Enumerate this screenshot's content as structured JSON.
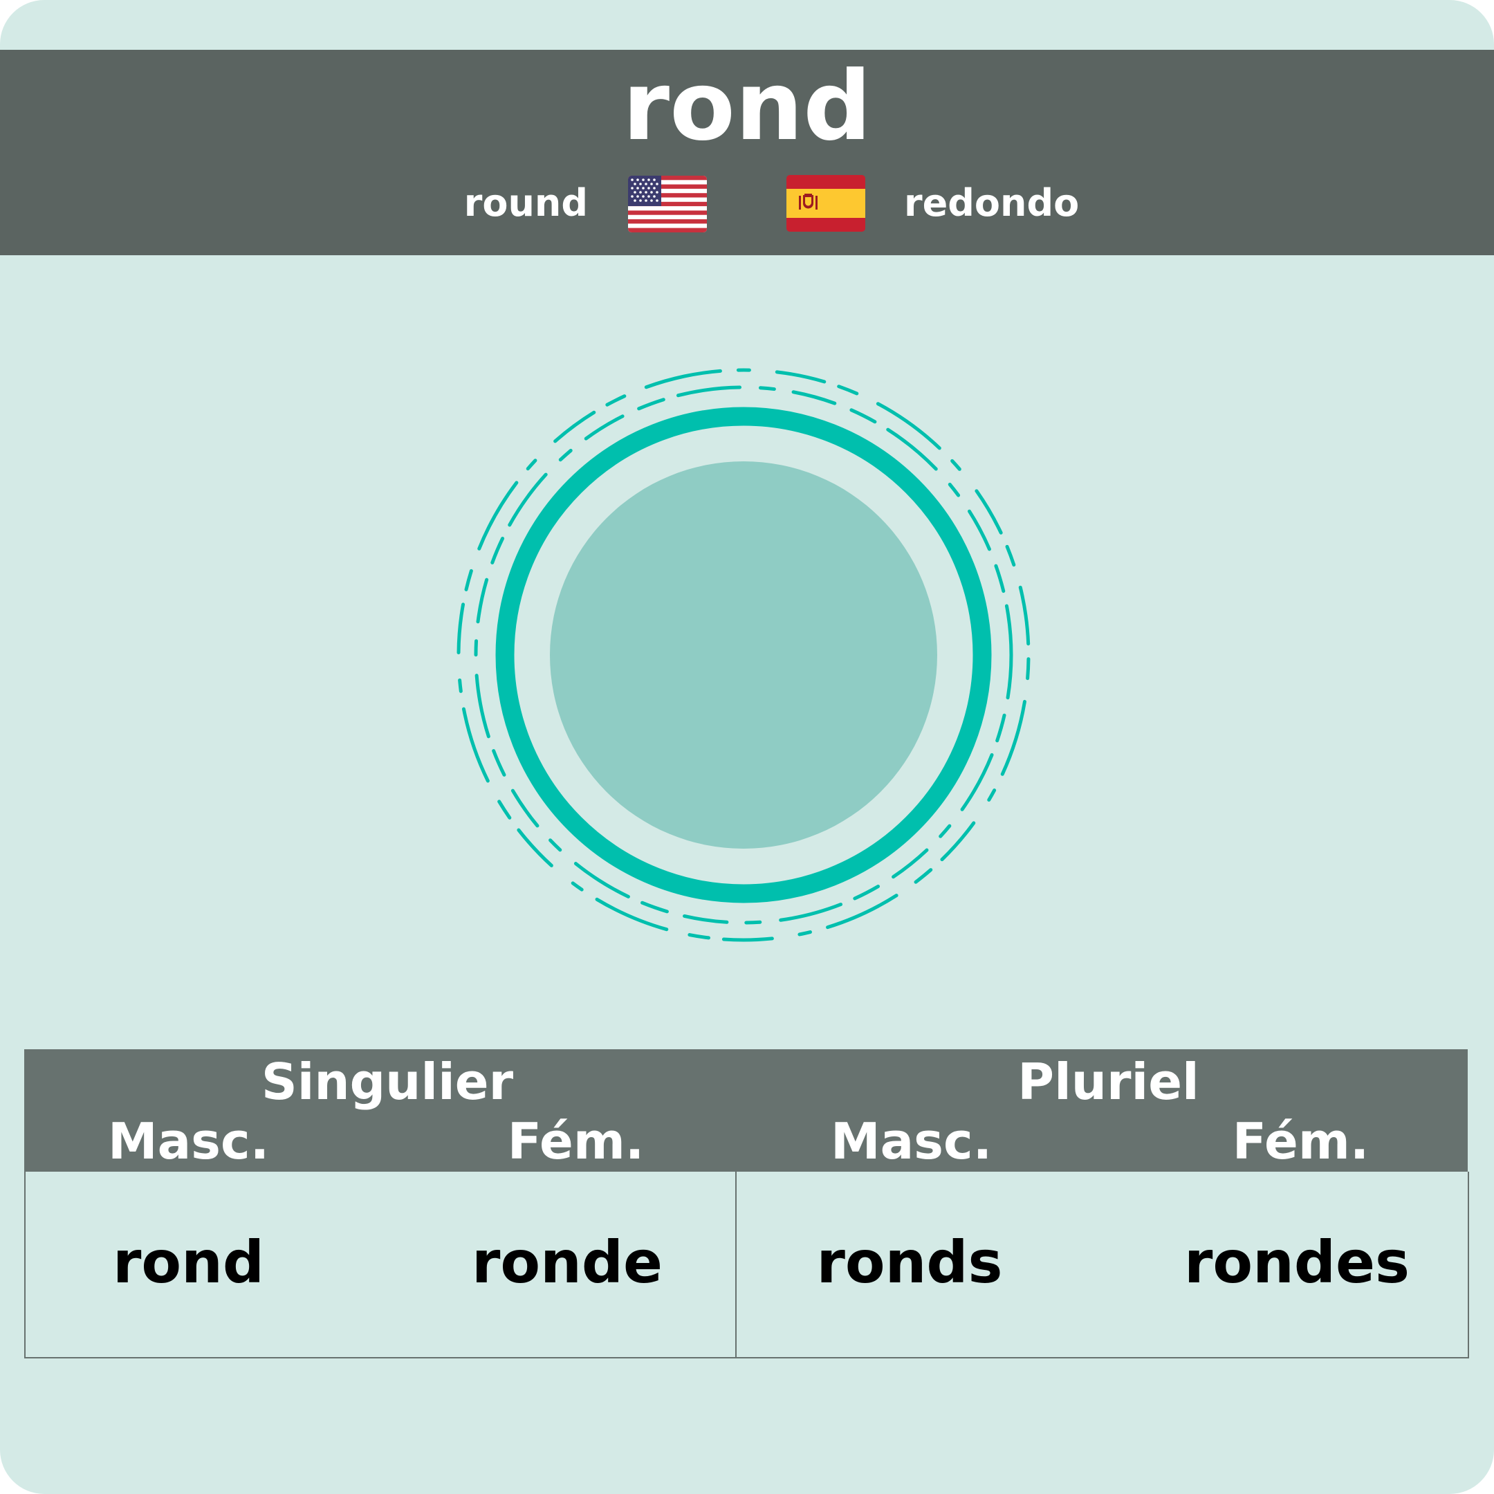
{
  "word": "rond",
  "translations": {
    "english": "round",
    "spanish": "redondo"
  },
  "flags": {
    "english": "us-flag-icon",
    "spanish": "spain-flag-icon"
  },
  "illustration": "round-circle-icon",
  "colors": {
    "background": "#d4eae6",
    "header": "#5b6461",
    "table_header": "#67726f",
    "accent": "#00bfad",
    "circle_fill": "#8fccc4"
  },
  "declension": {
    "singular": {
      "label": "Singulier",
      "masc_label": "Masc.",
      "fem_label": "Fém.",
      "masc": "rond",
      "fem": "ronde"
    },
    "plural": {
      "label": "Pluriel",
      "masc_label": "Masc.",
      "fem_label": "Fém.",
      "masc": "ronds",
      "fem": "rondes"
    }
  }
}
